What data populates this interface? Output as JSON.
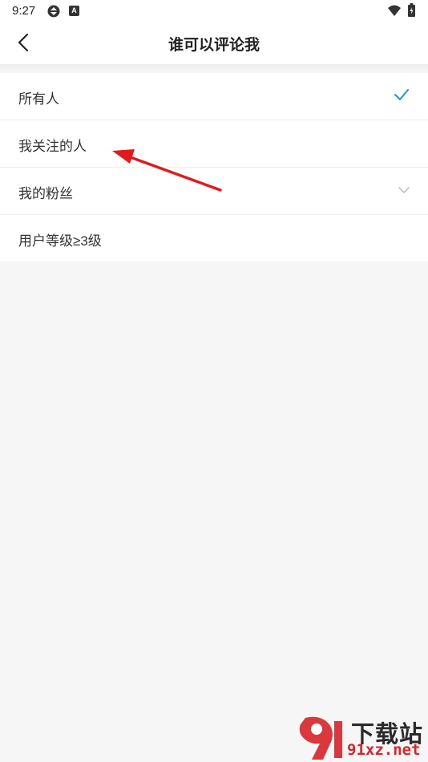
{
  "status_bar": {
    "time": "9:27",
    "icons": [
      "sync-icon",
      "a-badge-icon",
      "wifi-icon",
      "battery-charging-icon"
    ]
  },
  "header": {
    "title": "谁可以评论我",
    "back_icon": "chevron-left-icon"
  },
  "options": [
    {
      "label": "所有人",
      "selected": true,
      "icon": "checkmark-icon"
    },
    {
      "label": "我关注的人",
      "selected": false
    },
    {
      "label": "我的粉丝",
      "selected": false,
      "icon": "chevron-down-icon"
    },
    {
      "label": "用户等级≥3级",
      "selected": false
    }
  ],
  "watermark": {
    "brand": "下载站",
    "url": "91xz.net"
  },
  "colors": {
    "accent": "#1e8ee6",
    "annotation": "#e01b1b",
    "background": "#f6f6f6"
  }
}
